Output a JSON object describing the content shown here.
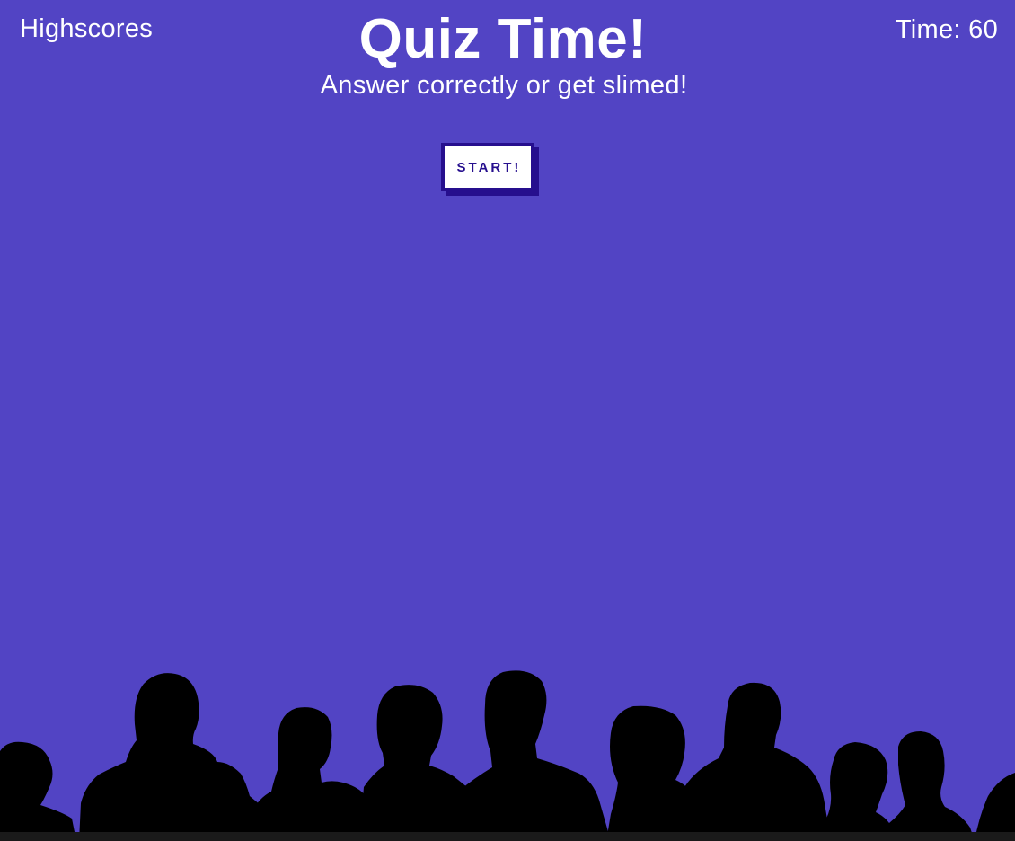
{
  "header": {
    "highscores_label": "Highscores",
    "title": "Quiz Time!",
    "subtitle": "Answer correctly or get slimed!",
    "timer_text": "Time: 60"
  },
  "start_button": {
    "label": "START!"
  },
  "colors": {
    "background": "#5244c4",
    "text": "#ffffff",
    "button_accent": "#260f8e",
    "crowd": "#000000"
  },
  "decor": {
    "crowd_icon": "audience-silhouette"
  }
}
